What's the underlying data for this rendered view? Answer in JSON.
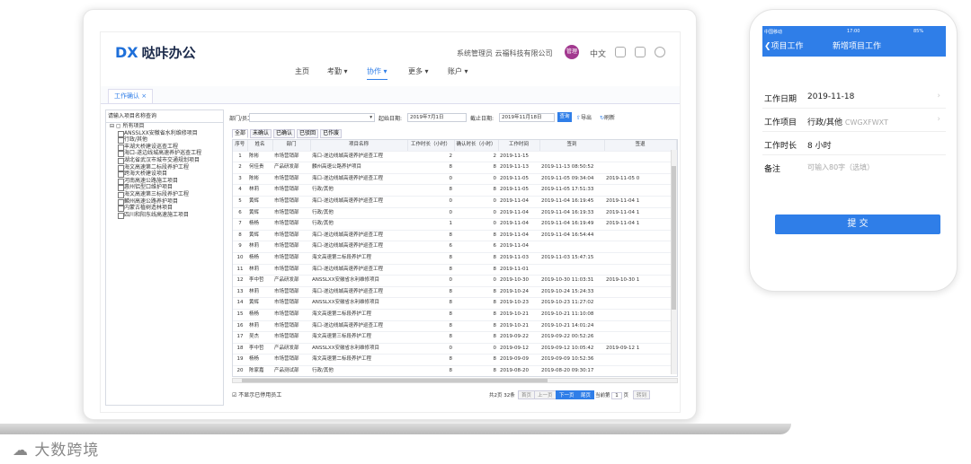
{
  "app": {
    "logo_mark": "DX",
    "logo_text": "哒咔办公",
    "company": "系统管理员 云福科技有限公司",
    "avatar_text": "管理",
    "lang": "中文"
  },
  "nav": [
    "主页",
    "考勤 ▾",
    "协作 ▾",
    "更多 ▾",
    "账户 ▾"
  ],
  "tab": "工作确认 ×",
  "left": {
    "search_placeholder": "请输入项目名称查询",
    "root": "所有项目",
    "items": [
      "ANSSLXX安徽省水利维修项目",
      "行政/其他",
      "丰湖大桥建设巡查工程",
      "海口-遂边线城高速养护巡查工程",
      "湖北省武汉市城市交通规划项目",
      "海文高速第二标段养护工程",
      "跨海大桥建设项目",
      "河南高速公路施工项目",
      "惠州铝型口维护项目",
      "海文高速第三标段养护工程",
      "麟州高速公路养护项目",
      "内蒙古植树造林项目",
      "四川和阳东线高速施工项目"
    ]
  },
  "filter": {
    "dept_label": "部门/员工:",
    "start_label": "起始日期:",
    "start_value": "2019年7月1日",
    "end_label": "截止日期:",
    "end_value": "2019年11月18日",
    "query": "查询",
    "export": "导出",
    "refresh": "刷新"
  },
  "subtabs": [
    "全部",
    "未确认",
    "已确认",
    "已驳回",
    "已作废"
  ],
  "columns": [
    "序号",
    "姓名",
    "部门",
    "项目名称",
    "工作时长（小时）",
    "确认时长（小时）",
    "工作时间",
    "签到",
    "签退"
  ],
  "rows": [
    [
      "1",
      "陈彬",
      "市场营销部",
      "海口-遂边线城高速养护巡查工程",
      "2",
      "2",
      "2019-11-15",
      "",
      ""
    ],
    [
      "2",
      "何佳贵",
      "产品研发部",
      "麟州高速公路养护项目",
      "8",
      "8",
      "2019-11-13",
      "2019-11-13 08:50:52",
      ""
    ],
    [
      "3",
      "陈彬",
      "市场营销部",
      "海口-遂边线城高速养护巡查工程",
      "0",
      "0",
      "2019-11-05",
      "2019-11-05 09:34:04",
      "2019-11-05 0"
    ],
    [
      "4",
      "林莉",
      "市场营销部",
      "行政/其他",
      "8",
      "8",
      "2019-11-05",
      "2019-11-05 17:51:33",
      ""
    ],
    [
      "5",
      "黄辉",
      "市场营销部",
      "海口-遂边线城高速养护巡查工程",
      "0",
      "0",
      "2019-11-04",
      "2019-11-04 16:19:45",
      "2019-11-04 1"
    ],
    [
      "6",
      "黄辉",
      "市场营销部",
      "行政/其他",
      "0",
      "0",
      "2019-11-04",
      "2019-11-04 16:19:33",
      "2019-11-04 1"
    ],
    [
      "7",
      "杨杨",
      "市场营销部",
      "行政/其他",
      "1",
      "0",
      "2019-11-04",
      "2019-11-04 16:19:49",
      "2019-11-04 1"
    ],
    [
      "8",
      "黄辉",
      "市场营销部",
      "海口-遂边线城高速养护巡查工程",
      "8",
      "8",
      "2019-11-04",
      "2019-11-04 16:54:44",
      ""
    ],
    [
      "9",
      "林莉",
      "市场营销部",
      "海口-遂边线城高速养护巡查工程",
      "6",
      "6",
      "2019-11-04",
      "",
      ""
    ],
    [
      "10",
      "杨杨",
      "市场营销部",
      "海文高速第二标段养护工程",
      "8",
      "8",
      "2019-11-03",
      "2019-11-03 15:47:15",
      ""
    ],
    [
      "11",
      "林莉",
      "市场营销部",
      "海口-遂边线城高速养护巡查工程",
      "8",
      "8",
      "2019-11-01",
      "",
      ""
    ],
    [
      "12",
      "李中哲",
      "产品研发部",
      "ANSSLXX安徽省水利维修项目",
      "0",
      "0",
      "2019-10-30",
      "2019-10-30 11:03:31",
      "2019-10-30 1"
    ],
    [
      "13",
      "林莉",
      "市场营销部",
      "海口-遂边线城高速养护巡查工程",
      "8",
      "8",
      "2019-10-24",
      "2019-10-24 15:24:33",
      ""
    ],
    [
      "14",
      "黄辉",
      "市场营销部",
      "ANSSLXX安徽省水利维修项目",
      "8",
      "8",
      "2019-10-23",
      "2019-10-23 11:27:02",
      ""
    ],
    [
      "15",
      "杨杨",
      "市场营销部",
      "海文高速第二标段养护工程",
      "8",
      "8",
      "2019-10-21",
      "2019-10-21 11:10:08",
      ""
    ],
    [
      "16",
      "林莉",
      "市场营销部",
      "海口-遂边线城高速养护巡查工程",
      "8",
      "8",
      "2019-10-21",
      "2019-10-21 14:01:24",
      ""
    ],
    [
      "17",
      "吴杰",
      "市场营销部",
      "海文高速第三标段养护工程",
      "8",
      "8",
      "2019-09-22",
      "2019-09-22 00:52:26",
      ""
    ],
    [
      "18",
      "李中哲",
      "产品研发部",
      "ANSSLXX安徽省水利维修项目",
      "0",
      "0",
      "2019-09-12",
      "2019-09-12 10:05:42",
      "2019-09-12 1"
    ],
    [
      "19",
      "杨杨",
      "市场营销部",
      "海文高速第二标段养护工程",
      "8",
      "8",
      "2019-09-09",
      "2019-09-09 10:52:36",
      ""
    ],
    [
      "20",
      "陈家嘉",
      "产品测试部",
      "行政/其他",
      "8",
      "8",
      "2019-08-20",
      "2019-08-20 09:30:17",
      ""
    ],
    [
      "21",
      "陈家嘉",
      "产品测试部",
      "ANSSLXX安徽省水利维修项目",
      "8",
      "8",
      "2019-08-15",
      "2019-08-15 09:40:13",
      ""
    ]
  ],
  "footer": {
    "checkbox": "不显示已停用员工",
    "summary": "共2页 32条",
    "first": "首页",
    "prev": "上一页",
    "next": "下一页",
    "last": "尾页",
    "current_label": "当前第",
    "page": "1",
    "page_unit": "页",
    "go": "转到"
  },
  "phone": {
    "carrier": "中国移动",
    "time": "17:00",
    "battery": "85%",
    "back": "项目工作",
    "title": "新增项目工作",
    "fields": [
      {
        "label": "工作日期",
        "value": "2019-11-18"
      },
      {
        "label": "工作项目",
        "value": "行政/其他",
        "hint": "CWGXFWXT"
      },
      {
        "label": "工作时长",
        "value": "8 小时"
      },
      {
        "label": "备注",
        "placeholder": "可输入80字（选填）"
      }
    ],
    "submit": "提  交"
  },
  "watermark": "大数跨境"
}
